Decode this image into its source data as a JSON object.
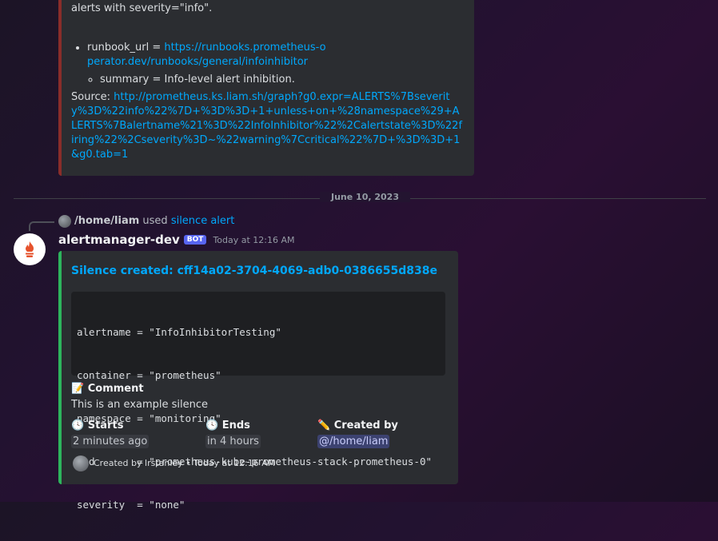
{
  "prev_embed": {
    "text": "This alert should be routed to a null receiver and configured to inhibit alerts with severity=\"info\".",
    "runbook_label": "runbook_url = ",
    "runbook_link": "https://runbooks.prometheus-operator.dev/runbooks/general/infoinhibitor",
    "summary": "summary = Info-level alert inhibition.",
    "source_label": "Source: ",
    "source_link": "http://prometheus.ks.liam.sh/graph?g0.expr=ALERTS%7Bseverity%3D%22info%22%7D+%3D%3D+1+unless+on+%28namespace%29+ALERTS%7Balertname%21%3D%22InfoInhibitor%22%2Calertstate%3D%22firing%22%2Cseverity%3D~%22warning%7Ccritical%22%7D+%3D%3D+1&g0.tab=1",
    "accent_color": "#8a2d2a"
  },
  "divider": {
    "date": "June 10, 2023"
  },
  "reply": {
    "user": "/home/liam",
    "used": " used ",
    "command": "silence alert"
  },
  "message": {
    "username": "alertmanager-dev",
    "bot_tag": "BOT",
    "timestamp": "Today at 12:16 AM"
  },
  "embed": {
    "title": "Silence created: cff14a02-3704-4069-adb0-0386655d838e",
    "accent_color": "#2db55d",
    "matchers": [
      "alertname = \"InfoInhibitorTesting\"",
      "container = \"prometheus\"",
      "namespace = \"monitoring\"",
      "pod       = \"prometheus-kube-prometheus-stack-prometheus-0\"",
      "severity  = \"none\""
    ],
    "comment": {
      "emoji": "📝",
      "name": "Comment",
      "value": "This is an example silence"
    },
    "fields": [
      {
        "emoji": "🕓",
        "name": "Starts",
        "value": "2 minutes ago"
      },
      {
        "emoji": "🕓",
        "name": "Ends",
        "value": "in 4 hours"
      },
      {
        "emoji": "✏️",
        "name": "Created by",
        "value": "@/home/liam"
      }
    ],
    "footer": "Created by lrstanley • Today at 12:16 AM"
  }
}
